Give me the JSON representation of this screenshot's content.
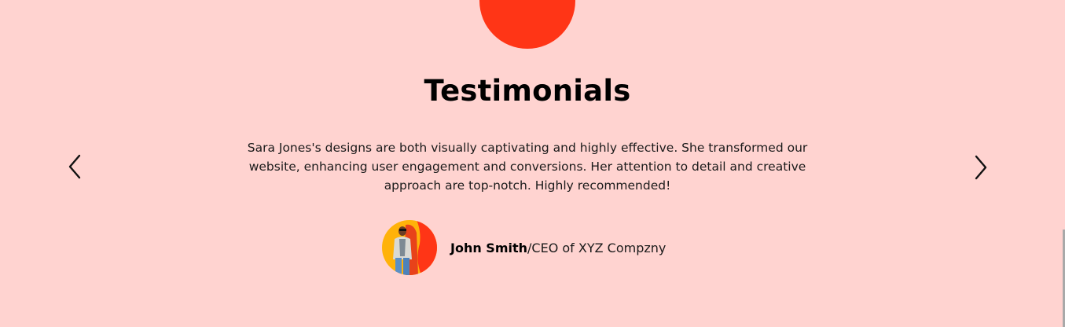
{
  "section": {
    "title": "Testimonials",
    "accent_color": "#ff3516",
    "background_color": "#ffd3d0"
  },
  "testimonial": {
    "quote": "Sara Jones's designs are both visually captivating and highly effective. She transformed our website, enhancing user engagement and conversions. Her attention to detail and creative approach are top-notch. Highly recommended!",
    "author_name": "John Smith",
    "author_role": "/CEO of XYZ Compzny"
  },
  "navigation": {
    "prev_icon": "chevron-left-icon",
    "next_icon": "chevron-right-icon"
  }
}
